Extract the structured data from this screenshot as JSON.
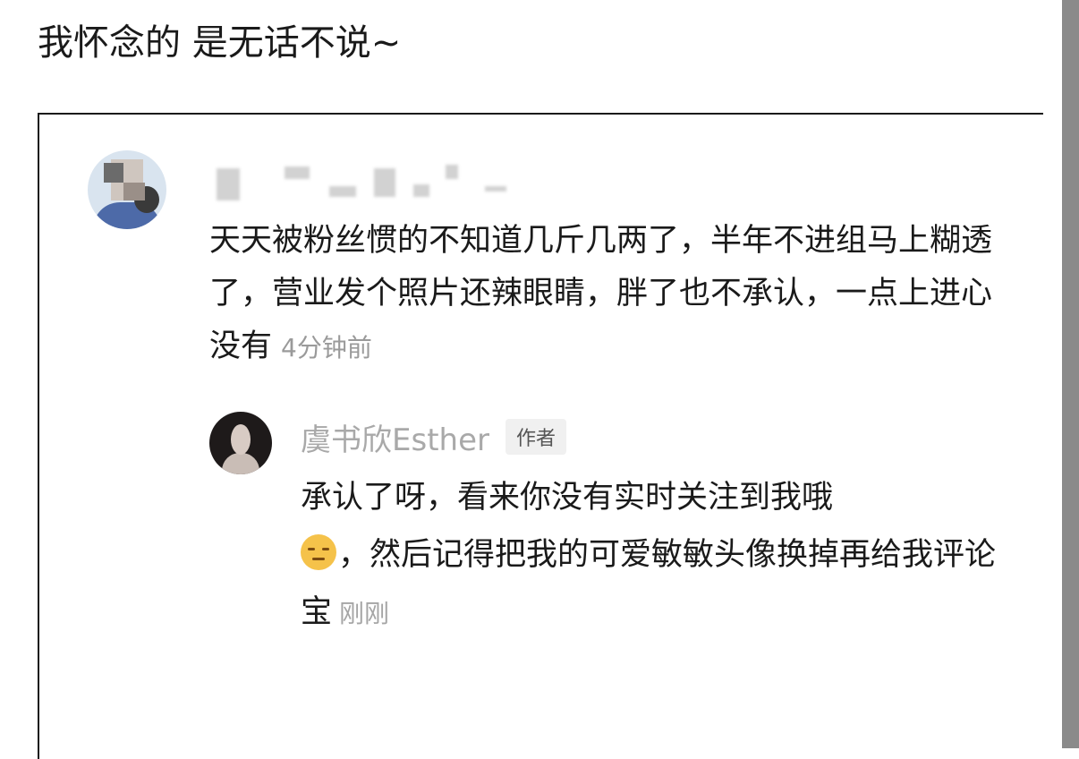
{
  "post": {
    "title": "我怀念的 是无话不说~"
  },
  "comment": {
    "username_blurred": true,
    "text": "天天被粉丝惯的不知道几斤几两了，半年不进组马上糊透了，营业发个照片还辣眼睛，胖了也不承认，一点上进心没有",
    "time": "4分钟前"
  },
  "reply": {
    "username": "虞书欣Esther",
    "badge": "作者",
    "text_before_emoji": "承认了呀，看来你没有实时关注到我哦",
    "emoji": "pensive-face-emoji",
    "text_after_emoji": "，然后记得把我的可爱敏敏头像换掉再给我评论宝",
    "time": "刚刚"
  },
  "colors": {
    "text": "#1a1a1a",
    "muted": "#a9a9a9",
    "badge_bg": "#f0f0f0",
    "right_bar": "#8a8a8a"
  }
}
